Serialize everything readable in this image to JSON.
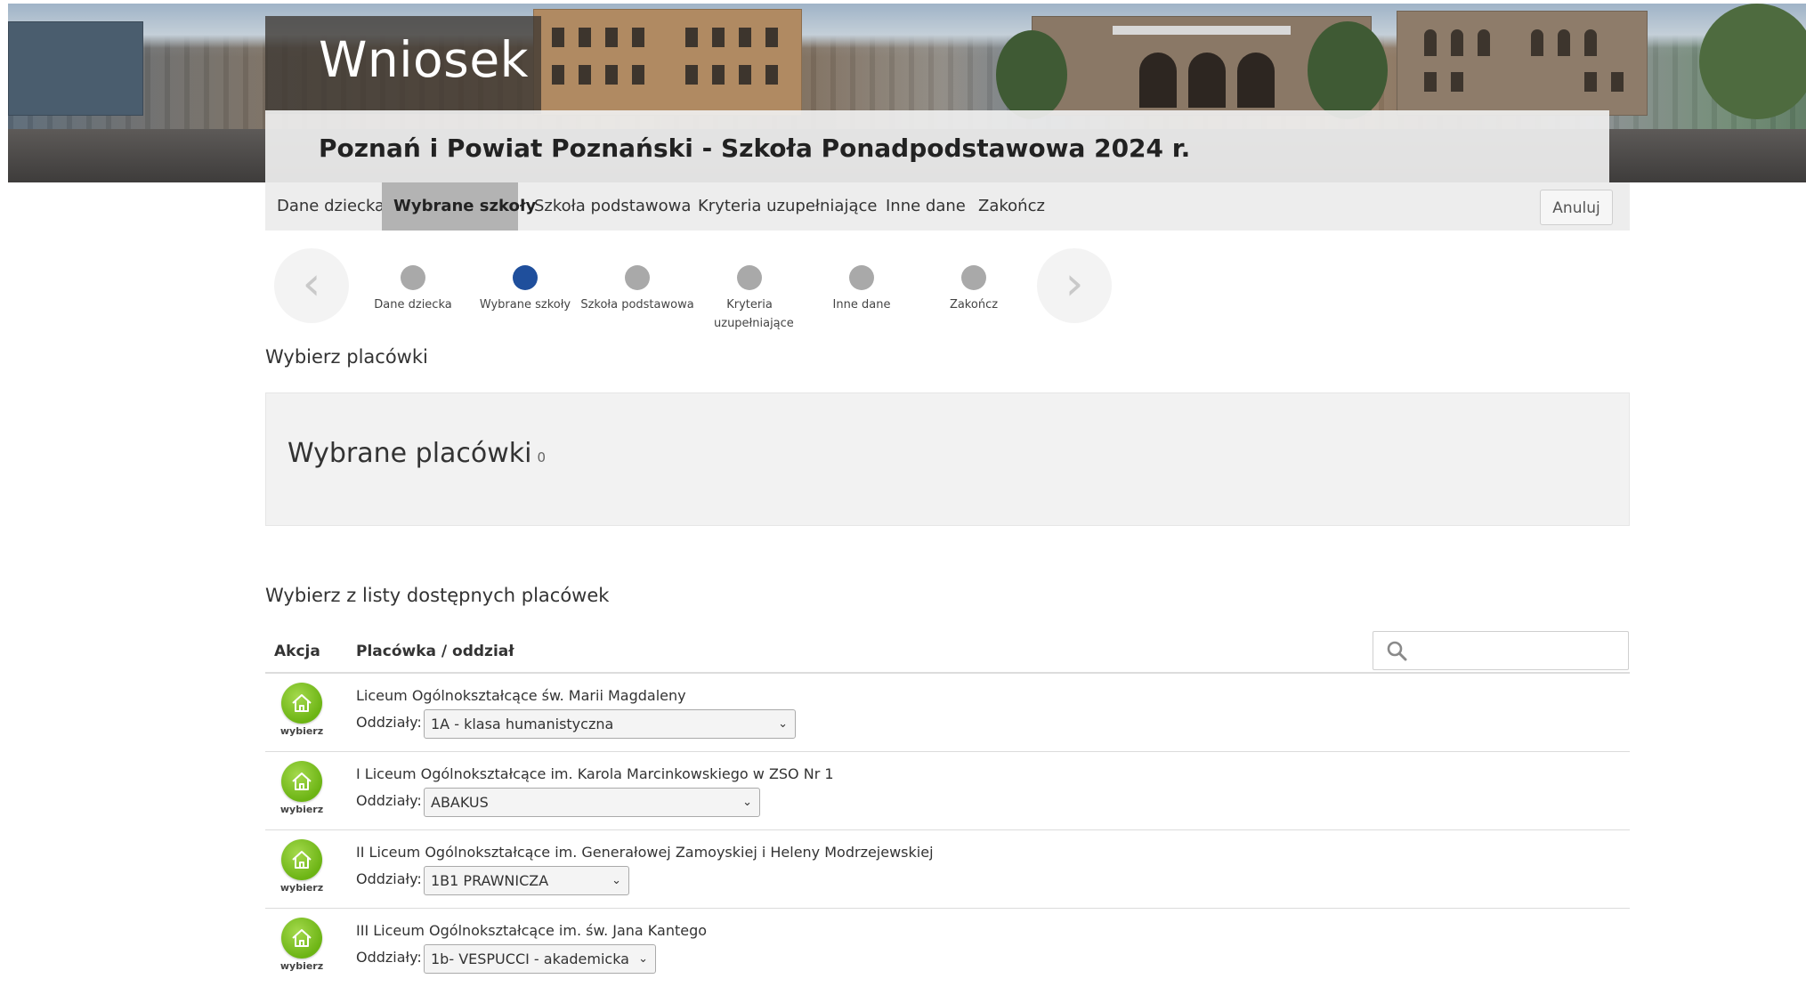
{
  "banner": {
    "title": "Wniosek",
    "subtitle": "Poznań i Powiat Poznański - Szkoła Ponadpodstawowa 2024 r."
  },
  "nav": {
    "tabs": [
      {
        "label": "Dane dziecka",
        "active": false
      },
      {
        "label": "Wybrane szkoły",
        "active": true
      },
      {
        "label": "Szkoła podstawowa",
        "active": false
      },
      {
        "label": "Kryteria uzupełniające",
        "active": false
      },
      {
        "label": "Inne dane",
        "active": false
      },
      {
        "label": "Zakończ",
        "active": false
      }
    ],
    "cancel_label": "Anuluj"
  },
  "stepper": {
    "steps": [
      {
        "label": "Dane dziecka",
        "active": false
      },
      {
        "label": "Wybrane szkoły",
        "active": true
      },
      {
        "label": "Szkoła podstawowa",
        "active": false
      },
      {
        "label": "Kryteria uzupełniające",
        "active": false
      },
      {
        "label": "Inne dane",
        "active": false
      },
      {
        "label": "Zakończ",
        "active": false
      }
    ],
    "prev_icon": "chevron-left-icon",
    "next_icon": "chevron-right-icon"
  },
  "choose_heading": "Wybierz placówki",
  "selected": {
    "title": "Wybrane placówki",
    "count": "0"
  },
  "list_heading": "Wybierz z listy dostępnych placówek",
  "table": {
    "headers": {
      "action": "Akcja",
      "facility": "Placówka / oddział"
    },
    "search_placeholder": "",
    "search_icon": "search-icon",
    "pick_label": "wybierz",
    "branch_label": "Oddziały:",
    "rows": [
      {
        "name": "Liceum Ogólnokształcące św. Marii Magdaleny",
        "branch": "1A - klasa humanistyczna"
      },
      {
        "name": "I Liceum Ogólnokształcące im. Karola Marcinkowskiego w ZSO Nr 1",
        "branch": "ABAKUS"
      },
      {
        "name": "II Liceum Ogólnokształcące im. Generałowej Zamoyskiej i Heleny Modrzejewskiej",
        "branch": "1B1 PRAWNICZA"
      },
      {
        "name": "III Liceum Ogólnokształcące im. św. Jana Kantego",
        "branch": "1b- VESPUCCI - akademicka"
      }
    ]
  },
  "colors": {
    "active_tab_bg": "#b3b3b3",
    "active_step": "#1f4f9c",
    "inactive_step": "#a9a9a9",
    "pick_button": "#6cb414"
  }
}
